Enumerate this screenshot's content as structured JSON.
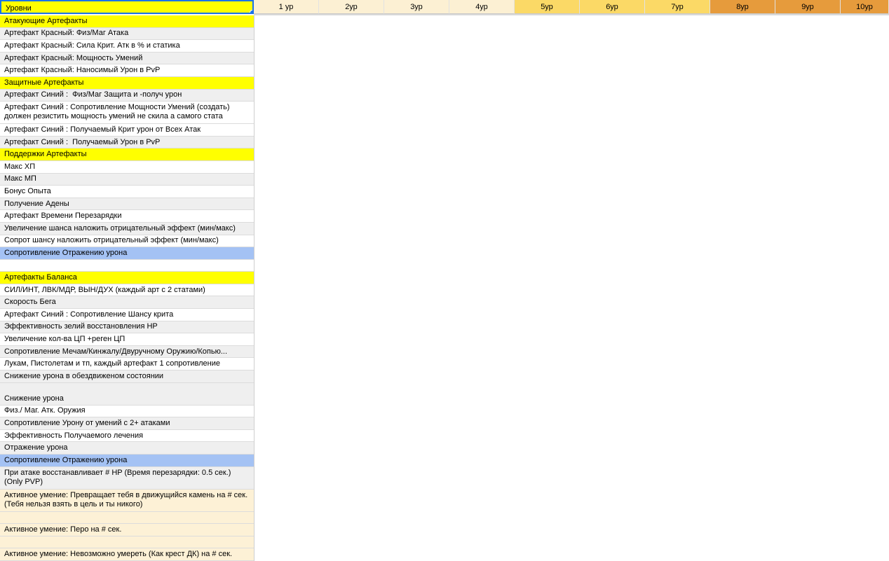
{
  "header": {
    "title": "Уровни",
    "levels": [
      {
        "label": "1 ур",
        "bg": "#fcf0d3"
      },
      {
        "label": "2ур",
        "bg": "#fcf0d3"
      },
      {
        "label": "3ур",
        "bg": "#fcf0d3"
      },
      {
        "label": "4ур",
        "bg": "#fcf0d3"
      },
      {
        "label": "5ур",
        "bg": "#fbd966"
      },
      {
        "label": "6ур",
        "bg": "#fbd966"
      },
      {
        "label": "7ур",
        "bg": "#fbd966"
      },
      {
        "label": "8ур",
        "bg": "#e69b3c"
      },
      {
        "label": "9ур",
        "bg": "#e69b3c"
      },
      {
        "label": "10ур",
        "bg": "#e69b3c"
      }
    ]
  },
  "rows": [
    {
      "text": "Атакующие Артефакты",
      "bg": "#ffff00",
      "kind": "section"
    },
    {
      "text": "Артефакт Красный: Физ/Маг Атака",
      "bg": "#efefef"
    },
    {
      "text": "Артефакт Красный: Сила Крит. Атк в % и статика",
      "bg": "#ffffff"
    },
    {
      "text": "Артефакт Красный: Мощность Умений",
      "bg": "#efefef"
    },
    {
      "text": "Артефакт Красный: Наносимый Урон в PvP",
      "bg": "#ffffff"
    },
    {
      "text": "Защитные Артефакты",
      "bg": "#ffff00",
      "kind": "section"
    },
    {
      "text": "Артефакт Синий :  Физ/Маг Защита и -получ урон",
      "bg": "#efefef"
    },
    {
      "text": "Артефакт Синий : Сопротивление Мощности Умений (создать)\nдолжен резистить мощность умений не скила а самого стата",
      "bg": "#ffffff",
      "h": 32
    },
    {
      "text": "Артефакт Синий : Получаемый Крит урон от Всех Атак",
      "bg": "#ffffff"
    },
    {
      "text": "Артефакт Синий :  Получаемый Урон в PvP",
      "bg": "#efefef"
    },
    {
      "text": "Поддержки Артефакты",
      "bg": "#ffff00",
      "kind": "section"
    },
    {
      "text": "Макс ХП",
      "bg": "#ffffff"
    },
    {
      "text": "Макс МП",
      "bg": "#efefef"
    },
    {
      "text": "Бонус Опыта",
      "bg": "#ffffff"
    },
    {
      "text": "Получение Адены",
      "bg": "#efefef"
    },
    {
      "text": "Артефакт Времени Перезарядки",
      "bg": "#ffffff"
    },
    {
      "text": "Увеличение шанса наложить отрицательный эффект (мин/макс)",
      "bg": "#efefef"
    },
    {
      "text": "Сопрот шансу наложить отрицательный эффект (мин/макс)",
      "bg": "#ffffff"
    },
    {
      "text": "Сопротивление Отражению урона",
      "bg": "#a4c2f4",
      "kind": "highlight"
    },
    {
      "text": "",
      "bg": "#ffffff"
    },
    {
      "text": "Артефакты Баланса",
      "bg": "#ffff00",
      "kind": "section"
    },
    {
      "text": "СИЛ/ИНТ, ЛВК/МДР, ВЫН/ДУХ (каждый арт с 2 статами)",
      "bg": "#ffffff"
    },
    {
      "text": "Скорость Бега",
      "bg": "#efefef"
    },
    {
      "text": "Артефакт Синий : Сопротивление Шансу крита",
      "bg": "#ffffff"
    },
    {
      "text": "Эффективность зелий восстановления HP",
      "bg": "#efefef"
    },
    {
      "text": "Увеличение кол-ва ЦП +реген ЦП",
      "bg": "#ffffff"
    },
    {
      "text": "Сопротивление Мечам/Кинжалу/Двуручному Оружию/Копью...",
      "bg": "#efefef"
    },
    {
      "text": "Лукам, Пистолетам и тп, каждый артефакт 1 сопротивление",
      "bg": "#ffffff"
    },
    {
      "text": "Снижение урона в обездвиженом состоянии",
      "bg": "#efefef"
    },
    {
      "text": "Снижение урона",
      "bg": "#efefef",
      "h": 32,
      "align": "bottom"
    },
    {
      "text": "Физ./ Маг. Атк. Оружия",
      "bg": "#ffffff"
    },
    {
      "text": "Сопротивление Урону от умений с 2+ атаками",
      "bg": "#efefef"
    },
    {
      "text": "Эффективность Получаемого лечения",
      "bg": "#ffffff"
    },
    {
      "text": "Отражение урона",
      "bg": "#efefef"
    },
    {
      "text": "Сопротивление Отражению урона",
      "bg": "#a4c2f4",
      "kind": "highlight"
    },
    {
      "text": "При атаке восстанавливает # HP (Время перезарядки: 0.5 сек.)\n(Only PVP)",
      "bg": "#efefef",
      "h": 32
    },
    {
      "text": "Активное умение: Превращает тебя в движущийся камень на # сек.\n(Тебя нельзя взять в цель и ты никого)",
      "bg": "#fdf1d6",
      "h": 32
    },
    {
      "text": "",
      "bg": "#fdf1d6"
    },
    {
      "text": "Активное умение: Перо на # сек.",
      "bg": "#fdf1d6"
    },
    {
      "text": "",
      "bg": "#fdf1d6"
    },
    {
      "text": "Активное умение: Невозможно умереть (Как крест ДК) на # сек.",
      "bg": "#fdf1d6"
    }
  ]
}
